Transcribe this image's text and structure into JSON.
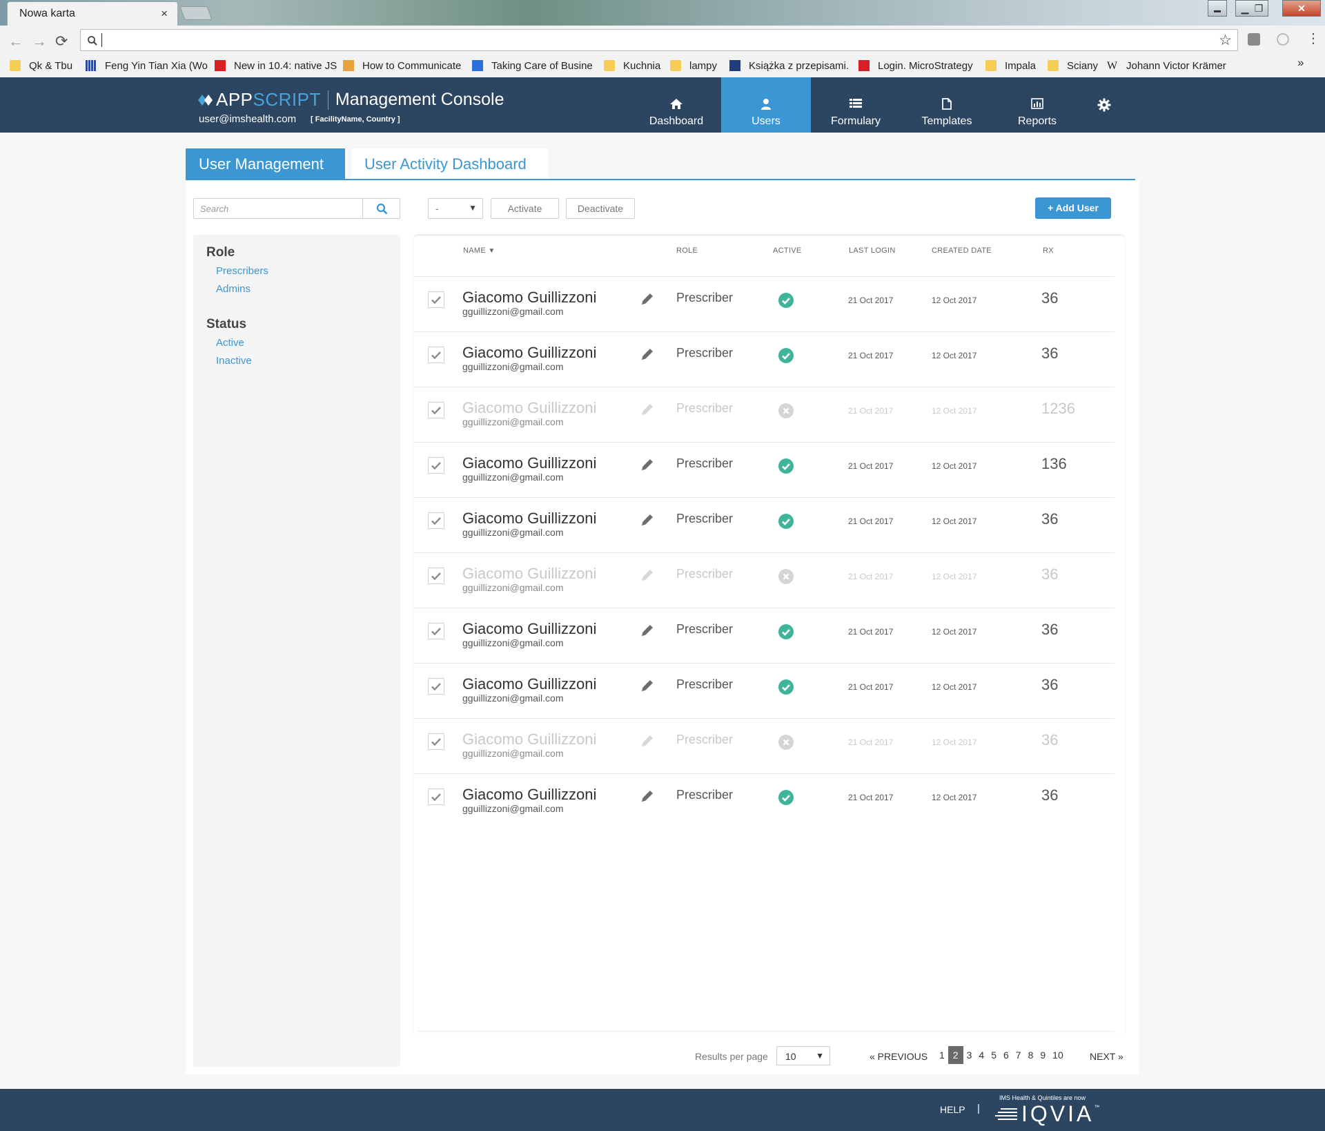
{
  "browser": {
    "tab_title": "Nowa karta",
    "tab_close": "×",
    "address_value": "",
    "bookmarks": [
      {
        "label": "Qk & Tbu",
        "icon": "folder-icon"
      },
      {
        "label": "Feng Yin Tian Xia (Wo",
        "icon": "grid-icon"
      },
      {
        "label": "New in 10.4: native JS",
        "icon": "m-icon"
      },
      {
        "label": "How to Communicate",
        "icon": "dog-icon"
      },
      {
        "label": "Taking Care of Busine",
        "icon": "g-icon"
      },
      {
        "label": "Kuchnia",
        "icon": "folder-icon"
      },
      {
        "label": "lampy",
        "icon": "folder-icon"
      },
      {
        "label": "Książka z przepisami.",
        "icon": "d-icon"
      },
      {
        "label": "Login. MicroStrategy",
        "icon": "m-icon"
      },
      {
        "label": "Impala",
        "icon": "folder-icon"
      },
      {
        "label": "Sciany",
        "icon": "folder-icon"
      },
      {
        "label": "Johann Victor Krämer",
        "icon": "wikipedia-icon"
      }
    ],
    "more_bookmarks": "»"
  },
  "header": {
    "brand_part1": "APP",
    "brand_part2": "SCRIPT",
    "brand_sub": "Management Console",
    "user_email": "user@imshealth.com",
    "facility": "[ FacilityName, Country ]",
    "nav": [
      {
        "label": "Dashboard",
        "icon": "home-icon",
        "active": false
      },
      {
        "label": "Users",
        "icon": "user-icon",
        "active": true
      },
      {
        "label": "Formulary",
        "icon": "list-icon",
        "active": false
      },
      {
        "label": "Templates",
        "icon": "document-icon",
        "active": false
      },
      {
        "label": "Reports",
        "icon": "bar-chart-icon",
        "active": false
      }
    ],
    "settings_icon": "gear-icon"
  },
  "page_tabs": [
    "User Management",
    "User Activity Dashboard"
  ],
  "search": {
    "placeholder": "Search",
    "value": ""
  },
  "filters": {
    "role_heading": "Role",
    "role_items": [
      "Prescribers",
      "Admins"
    ],
    "status_heading": "Status",
    "status_items": [
      "Active",
      "Inactive"
    ]
  },
  "actions": {
    "bulk_select_value": "-",
    "activate": "Activate",
    "deactivate": "Deactivate",
    "add_user": "+ Add User"
  },
  "table": {
    "columns": [
      "NAME",
      "ROLE",
      "ACTIVE",
      "LAST LOGIN",
      "CREATED DATE",
      "RX"
    ],
    "sort_indicator": "▼",
    "rows": [
      {
        "name": "Giacomo Guillizzoni",
        "email": "gguillizzoni@gmail.com",
        "role": "Prescriber",
        "active": true,
        "last_login": "21 Oct 2017",
        "created": "12 Oct 2017",
        "rx": "36"
      },
      {
        "name": "Giacomo Guillizzoni",
        "email": "gguillizzoni@gmail.com",
        "role": "Prescriber",
        "active": true,
        "last_login": "21 Oct 2017",
        "created": "12 Oct 2017",
        "rx": "36"
      },
      {
        "name": "Giacomo Guillizzoni",
        "email": "gguillizzoni@gmail.com",
        "role": "Prescriber",
        "active": false,
        "last_login": "21 Oct 2017",
        "created": "12 Oct 2017",
        "rx": "1236"
      },
      {
        "name": "Giacomo Guillizzoni",
        "email": "gguillizzoni@gmail.com",
        "role": "Prescriber",
        "active": true,
        "last_login": "21 Oct 2017",
        "created": "12 Oct 2017",
        "rx": "136"
      },
      {
        "name": "Giacomo Guillizzoni",
        "email": "gguillizzoni@gmail.com",
        "role": "Prescriber",
        "active": true,
        "last_login": "21 Oct 2017",
        "created": "12 Oct 2017",
        "rx": "36"
      },
      {
        "name": "Giacomo Guillizzoni",
        "email": "gguillizzoni@gmail.com",
        "role": "Prescriber",
        "active": false,
        "last_login": "21 Oct 2017",
        "created": "12 Oct 2017",
        "rx": "36"
      },
      {
        "name": "Giacomo Guillizzoni",
        "email": "gguillizzoni@gmail.com",
        "role": "Prescriber",
        "active": true,
        "last_login": "21 Oct 2017",
        "created": "12 Oct 2017",
        "rx": "36"
      },
      {
        "name": "Giacomo Guillizzoni",
        "email": "gguillizzoni@gmail.com",
        "role": "Prescriber",
        "active": true,
        "last_login": "21 Oct 2017",
        "created": "12 Oct 2017",
        "rx": "36"
      },
      {
        "name": "Giacomo Guillizzoni",
        "email": "gguillizzoni@gmail.com",
        "role": "Prescriber",
        "active": false,
        "last_login": "21 Oct 2017",
        "created": "12 Oct 2017",
        "rx": "36"
      },
      {
        "name": "Giacomo Guillizzoni",
        "email": "gguillizzoni@gmail.com",
        "role": "Prescriber",
        "active": true,
        "last_login": "21 Oct 2017",
        "created": "12 Oct 2017",
        "rx": "36"
      }
    ]
  },
  "pagination": {
    "results_label": "Results per page",
    "per_page": "10",
    "previous": "« PREVIOUS",
    "next": "NEXT »",
    "pages": [
      "1",
      "2",
      "3",
      "4",
      "5",
      "6",
      "7",
      "8",
      "9",
      "10"
    ],
    "current_page": "2"
  },
  "footer": {
    "help": "HELP",
    "separator": "|",
    "tagline": "IMS Health & Quintiles are now",
    "logo": "IQVIA",
    "trademark": "™"
  },
  "colors": {
    "header_bg": "#2c4560",
    "accent": "#3a97d4",
    "active_green": "#3fb49a",
    "inactive_grey": "#cfcfcf"
  }
}
